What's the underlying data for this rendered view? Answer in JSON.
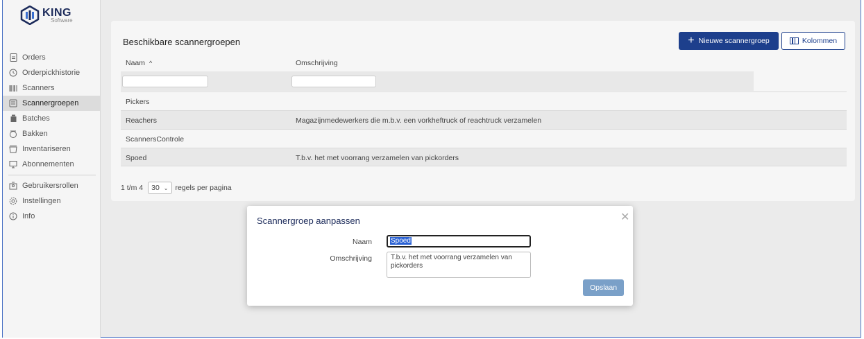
{
  "app": {
    "logo_main": "KING",
    "logo_sub": "Software"
  },
  "sidebar": {
    "items": [
      {
        "label": "Orders",
        "icon": "document-icon"
      },
      {
        "label": "Orderpickhistorie",
        "icon": "history-icon"
      },
      {
        "label": "Scanners",
        "icon": "barcode-icon"
      },
      {
        "label": "Scannergroepen",
        "icon": "scanner-group-icon",
        "active": true
      },
      {
        "label": "Batches",
        "icon": "batch-icon"
      },
      {
        "label": "Bakken",
        "icon": "bin-icon"
      },
      {
        "label": "Inventariseren",
        "icon": "inventory-icon"
      },
      {
        "label": "Abonnementen",
        "icon": "subscription-icon"
      },
      {
        "label": "Gebruikersrollen",
        "icon": "user-roles-icon"
      },
      {
        "label": "Instellingen",
        "icon": "gear-icon"
      },
      {
        "label": "Info",
        "icon": "info-icon"
      }
    ]
  },
  "main": {
    "title": "Beschikbare scannergroepen",
    "new_button": "Nieuwe scannergroep",
    "columns_button": "Kolommen",
    "columns": [
      "Naam",
      "Omschrijving"
    ],
    "sort_indicator": "^",
    "rows": [
      {
        "naam": "Pickers",
        "omschrijving": ""
      },
      {
        "naam": "Reachers",
        "omschrijving": "Magazijnmedewerkers die m.b.v. een vorkheftruck of reachtruck verzamelen"
      },
      {
        "naam": "ScannersControle",
        "omschrijving": ""
      },
      {
        "naam": "Spoed",
        "omschrijving": "T.b.v. het met voorrang verzamelen van pickorders"
      }
    ],
    "pager": {
      "range": "1 t/m 4",
      "page_size": "30",
      "per_page_label": "regels per pagina"
    }
  },
  "dialog": {
    "title": "Scannergroep aanpassen",
    "name_label": "Naam",
    "name_value": "Spoed",
    "desc_label": "Omschrijving",
    "desc_value": "T.b.v. het met voorrang verzamelen van pickorders",
    "save_button": "Opslaan"
  },
  "colors": {
    "primary": "#1d3f8c",
    "save_button": "#7aa0c8",
    "selection": "#2b62d4"
  }
}
